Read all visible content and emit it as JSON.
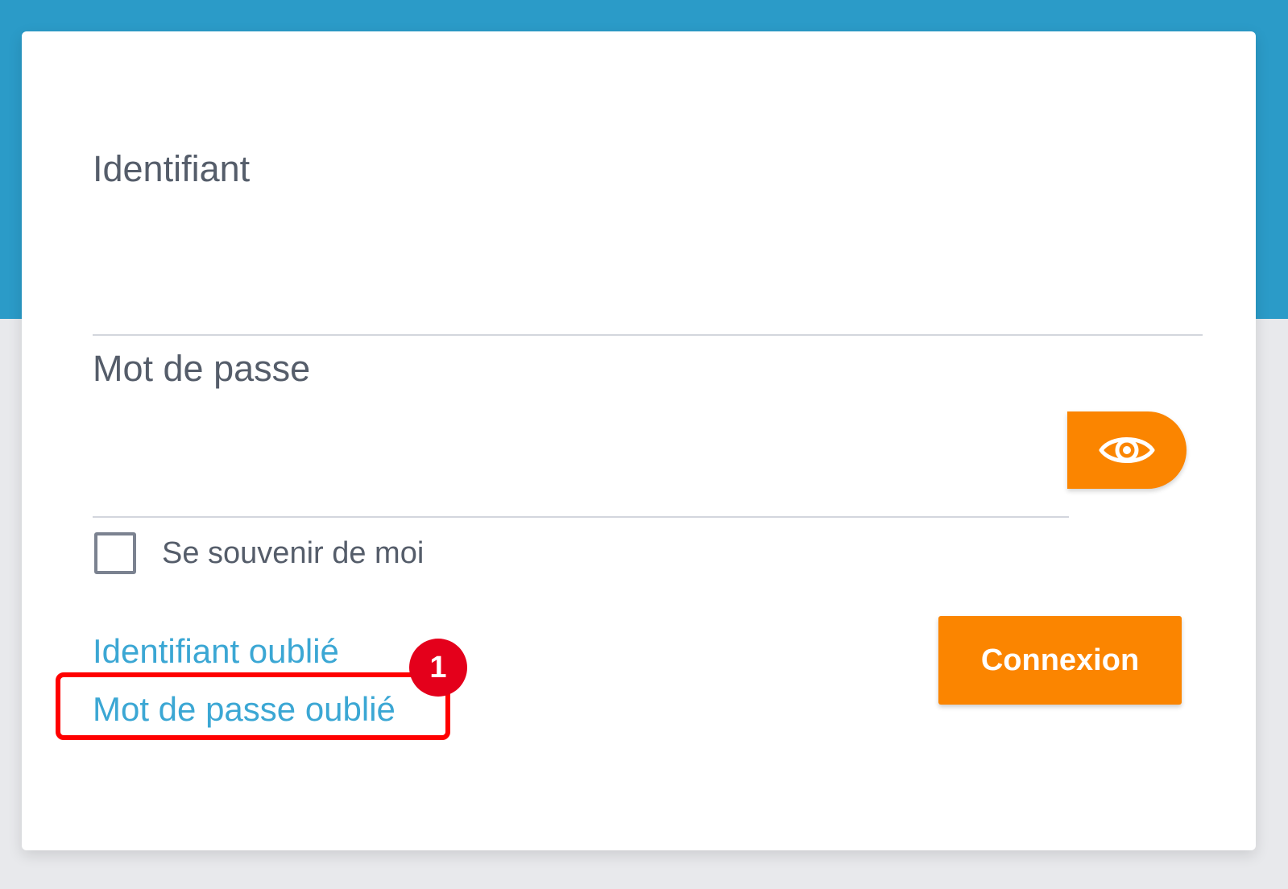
{
  "form": {
    "username_label": "Identifiant",
    "username_value": "",
    "password_label": "Mot de passe",
    "password_value": "",
    "toggle_icon": "eye-icon",
    "remember_label": "Se souvenir de moi",
    "remember_checked": false,
    "forgot_username_label": "Identifiant oublié",
    "forgot_password_label": "Mot de passe oublié",
    "submit_label": "Connexion"
  },
  "annotation": {
    "step_number": "1"
  },
  "colors": {
    "header_band": "#2b9bc8",
    "accent_orange": "#fb8500",
    "link_blue": "#3ba7d4",
    "highlight_red": "#ff0000",
    "badge_red": "#e4001b"
  }
}
